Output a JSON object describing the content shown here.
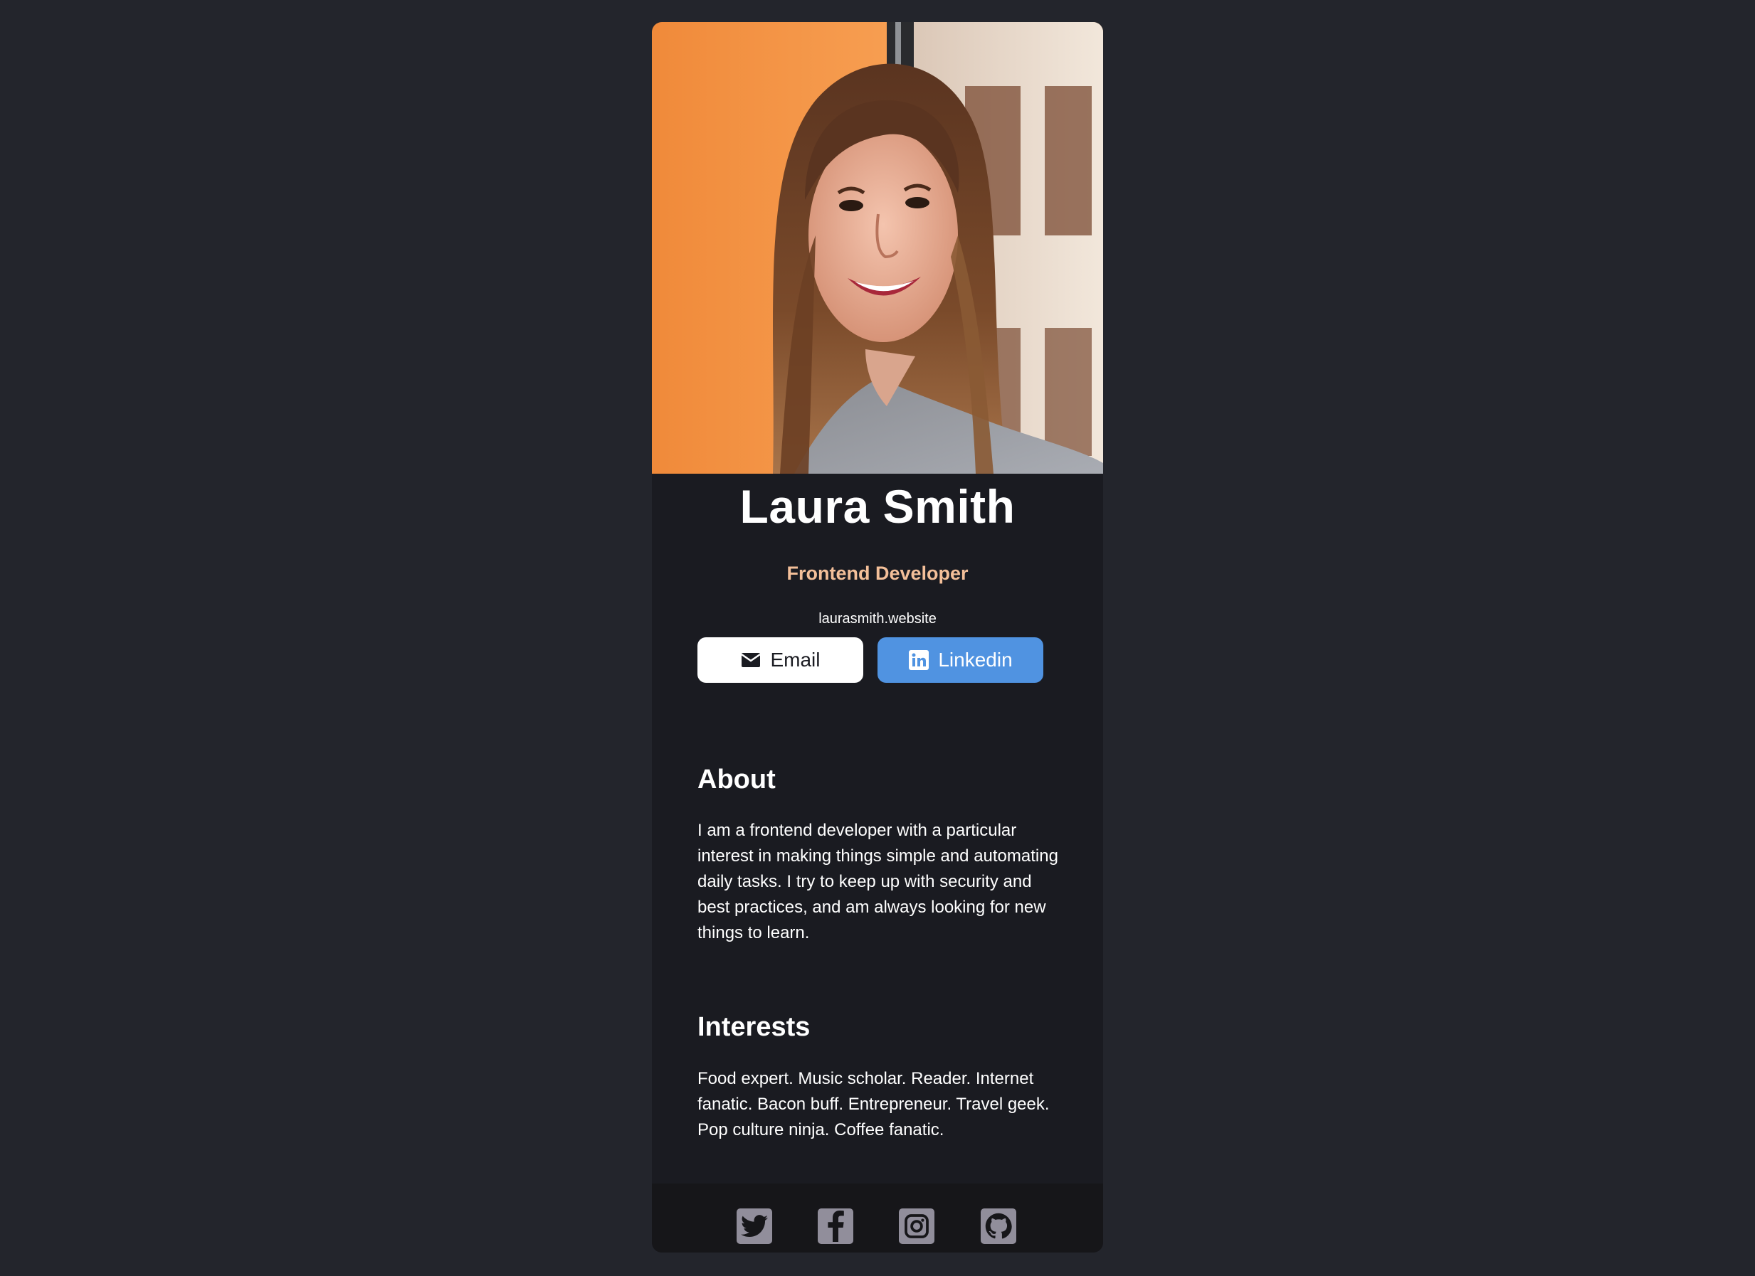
{
  "profile": {
    "name": "Laura Smith",
    "role": "Frontend Developer",
    "website": "laurasmith.website"
  },
  "buttons": {
    "email_label": "Email",
    "linkedin_label": "Linkedin"
  },
  "about": {
    "title": "About",
    "text": "I am a frontend developer with a particular interest in making things simple and automating daily tasks. I try to keep up with security and best practices, and am always looking for new things to learn."
  },
  "interests": {
    "title": "Interests",
    "text": "Food expert. Music scholar. Reader. Internet fanatic. Bacon buff. Entrepreneur. Travel geek. Pop culture ninja. Coffee fanatic."
  },
  "footer": {
    "social_icons": [
      "twitter-icon",
      "facebook-icon",
      "instagram-icon",
      "github-icon"
    ]
  },
  "colors": {
    "background": "#23252c",
    "card": "#1a1b21",
    "footer": "#161619",
    "role_accent": "#f3bf99",
    "linkedin_button": "#5093e1",
    "email_button": "#ffffff",
    "social_icon": "#918e9b"
  }
}
